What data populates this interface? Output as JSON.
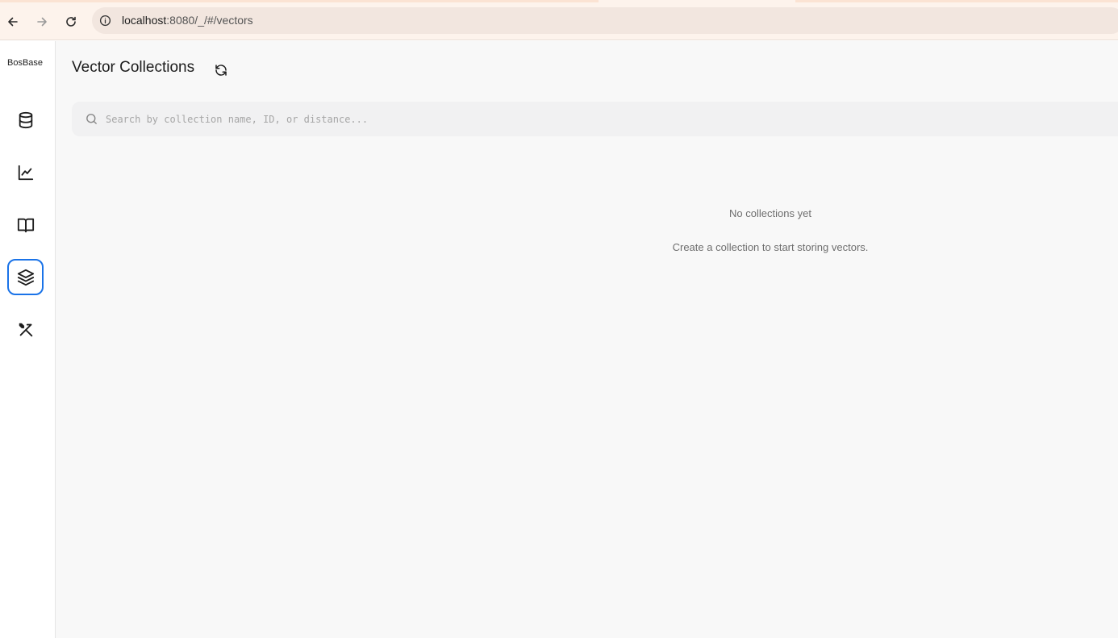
{
  "browser": {
    "url_host": "localhost",
    "url_path": ":8080/_/#/vectors"
  },
  "app": {
    "brand": "BosBase",
    "sidebar": {
      "items": [
        {
          "name": "database",
          "icon": "database-icon",
          "active": false
        },
        {
          "name": "analytics",
          "icon": "chart-line-icon",
          "active": false
        },
        {
          "name": "docs",
          "icon": "book-open-icon",
          "active": false
        },
        {
          "name": "vectors",
          "icon": "layers-icon",
          "active": true
        },
        {
          "name": "tools",
          "icon": "tools-icon",
          "active": false
        }
      ]
    },
    "accent_color": "#1a73e8"
  },
  "main": {
    "title": "Vector Collections",
    "search": {
      "placeholder": "Search by collection name, ID, or distance...",
      "value": ""
    },
    "empty_state": {
      "title": "No collections yet",
      "subtitle": "Create a collection to start storing vectors."
    }
  }
}
